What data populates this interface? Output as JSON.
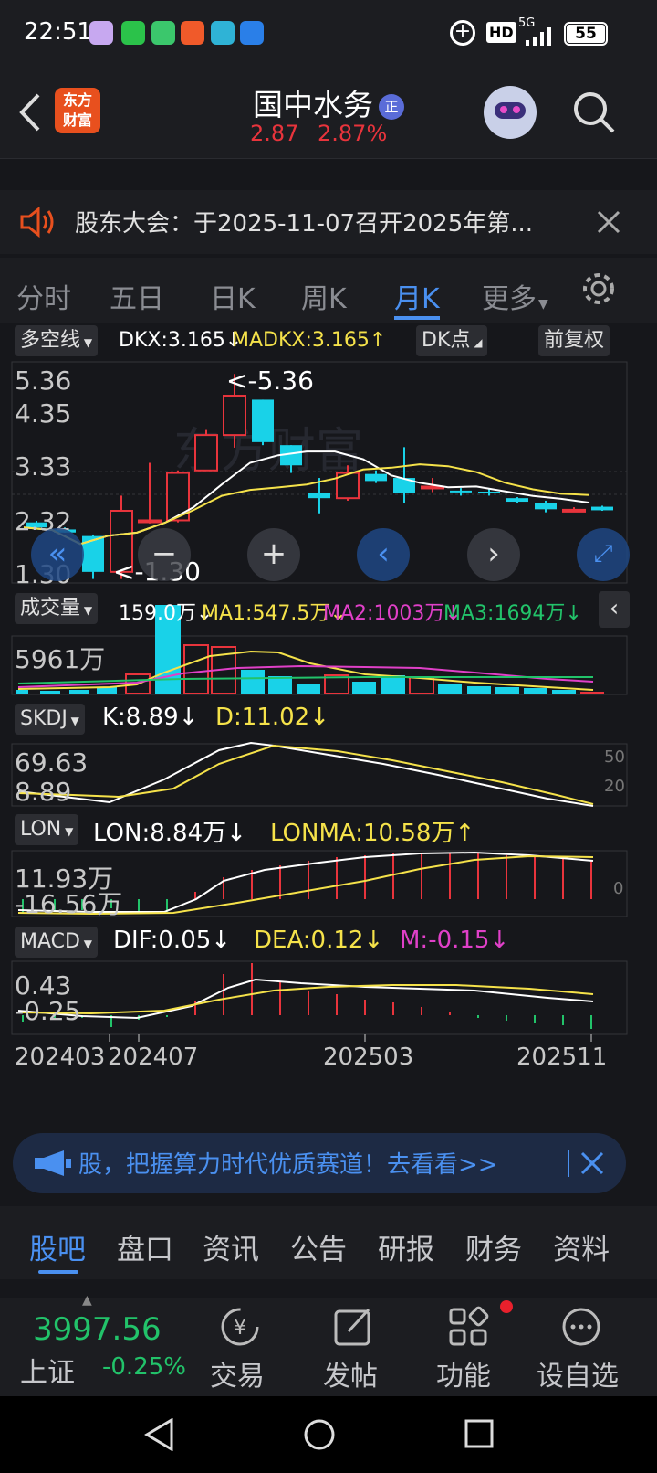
{
  "status": {
    "time": "22:51",
    "battery": "55",
    "net": "5G",
    "hd": "HD"
  },
  "header": {
    "name": "国中水务",
    "badge": "正",
    "price": "2.87",
    "change": "2.87%",
    "logo_line1": "东方",
    "logo_line2": "财富"
  },
  "notice": {
    "text": "股东大会：于2025-11-07召开2025年第..."
  },
  "tabs": [
    "分时",
    "五日",
    "日K",
    "周K",
    "月K",
    "更多"
  ],
  "main": {
    "indicator": "多空线",
    "dkx": "DKX:3.165",
    "madkx": "MADKX:3.165",
    "dk_point": "DK点",
    "fq": "前复权",
    "y_labels": [
      "5.36",
      "4.35",
      "3.33",
      "2.32",
      "1.30"
    ],
    "max_mark": "<-5.36",
    "min_mark": "<-1.30"
  },
  "vol": {
    "name": "成交量",
    "v": "159.0万",
    "ma1": "MA1:547.5万",
    "ma2": "MA2:1003万",
    "ma3": "MA3:1694万",
    "y": "5961万"
  },
  "skdj": {
    "name": "SKDJ",
    "k": "K:8.89",
    "d": "D:11.02",
    "y_top": "69.63",
    "y_bot": "8.89",
    "r50": "50",
    "r20": "20"
  },
  "lon": {
    "name": "LON",
    "lon": "LON:8.84万",
    "lonma": "LONMA:10.58万",
    "y_top": "11.93万",
    "y_bot": "-16.56万",
    "r0": "0"
  },
  "macd": {
    "name": "MACD",
    "dif": "DIF:0.05",
    "dea": "DEA:0.12",
    "m": "M:-0.15",
    "y_top": "0.43",
    "y_bot": "-0.25"
  },
  "xaxis": [
    "202403",
    "202407",
    "202503",
    "202511"
  ],
  "ad": {
    "text": "股，把握算力时代优质赛道！去看看>>"
  },
  "bottom_tabs": [
    "股吧",
    "盘口",
    "资讯",
    "公告",
    "研报",
    "财务",
    "资料"
  ],
  "index": {
    "value": "3997.56",
    "name": "上证",
    "change": "-0.25%"
  },
  "nav": [
    "交易",
    "发帖",
    "功能",
    "设自选"
  ],
  "colors": {
    "up": "#e8343c",
    "down": "#19d2e8",
    "accent": "#4a90f0",
    "green": "#22c36a",
    "yellow": "#f5e24a",
    "magenta": "#e040c8"
  },
  "chart_data": {
    "type": "candlestick",
    "period": "monthly",
    "candles": [
      {
        "o": 2.42,
        "h": 2.45,
        "l": 2.3,
        "c": 2.32
      },
      {
        "o": 2.28,
        "h": 2.32,
        "l": 2.22,
        "c": 2.22
      },
      {
        "o": 2.15,
        "h": 2.18,
        "l": 1.3,
        "c": 1.44
      },
      {
        "o": 1.44,
        "h": 2.95,
        "l": 1.3,
        "c": 2.65
      },
      {
        "o": 2.43,
        "h": 3.6,
        "l": 2.4,
        "c": 2.46
      },
      {
        "o": 2.46,
        "h": 3.45,
        "l": 2.42,
        "c": 3.4
      },
      {
        "o": 3.45,
        "h": 4.25,
        "l": 3.45,
        "c": 4.15
      },
      {
        "o": 4.15,
        "h": 5.36,
        "l": 3.9,
        "c": 4.93
      },
      {
        "o": 4.85,
        "h": 4.85,
        "l": 3.95,
        "c": 4.01
      },
      {
        "o": 3.95,
        "h": 3.95,
        "l": 3.4,
        "c": 3.55
      },
      {
        "o": 3.0,
        "h": 3.3,
        "l": 2.6,
        "c": 2.9
      },
      {
        "o": 2.9,
        "h": 3.55,
        "l": 2.85,
        "c": 3.4
      },
      {
        "o": 3.38,
        "h": 3.45,
        "l": 3.2,
        "c": 3.24
      },
      {
        "o": 3.3,
        "h": 3.91,
        "l": 2.8,
        "c": 3.0
      },
      {
        "o": 3.1,
        "h": 3.3,
        "l": 3.02,
        "c": 3.13
      },
      {
        "o": 3.05,
        "h": 3.1,
        "l": 2.95,
        "c": 3.02
      },
      {
        "o": 3.03,
        "h": 3.1,
        "l": 2.95,
        "c": 3.0
      },
      {
        "o": 2.9,
        "h": 2.92,
        "l": 2.8,
        "c": 2.83
      },
      {
        "o": 2.8,
        "h": 2.85,
        "l": 2.62,
        "c": 2.68
      },
      {
        "o": 2.67,
        "h": 2.72,
        "l": 2.63,
        "c": 2.67
      },
      {
        "o": 2.73,
        "h": 2.75,
        "l": 2.65,
        "c": 2.66
      }
    ]
  }
}
